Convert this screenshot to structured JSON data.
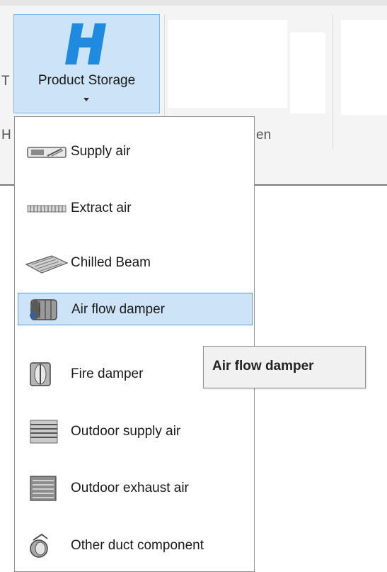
{
  "ribbon": {
    "product_storage_label": "Product Storage",
    "logo_letter": "H",
    "partial_char_left": "T",
    "partial_char_group": "H",
    "partial_text_right": "en"
  },
  "menu": {
    "items": [
      {
        "label": "Supply air",
        "icon": "supply-air-diffuser-icon"
      },
      {
        "label": "Extract air",
        "icon": "extract-air-grille-icon"
      },
      {
        "label": "Chilled Beam",
        "icon": "chilled-beam-icon"
      },
      {
        "label": "Air flow damper",
        "icon": "air-flow-damper-icon",
        "highlighted": true
      },
      {
        "label": "Fire damper",
        "icon": "fire-damper-icon"
      },
      {
        "label": "Outdoor supply air",
        "icon": "outdoor-supply-louver-icon"
      },
      {
        "label": "Outdoor exhaust air",
        "icon": "outdoor-exhaust-louver-icon"
      },
      {
        "label": "Other duct component",
        "icon": "duct-component-icon"
      }
    ]
  },
  "tooltip": {
    "text": "Air flow damper"
  },
  "colors": {
    "highlight_bg": "#cde3f7",
    "highlight_border": "#5b9bd5",
    "logo_blue": "#1f8be0"
  }
}
